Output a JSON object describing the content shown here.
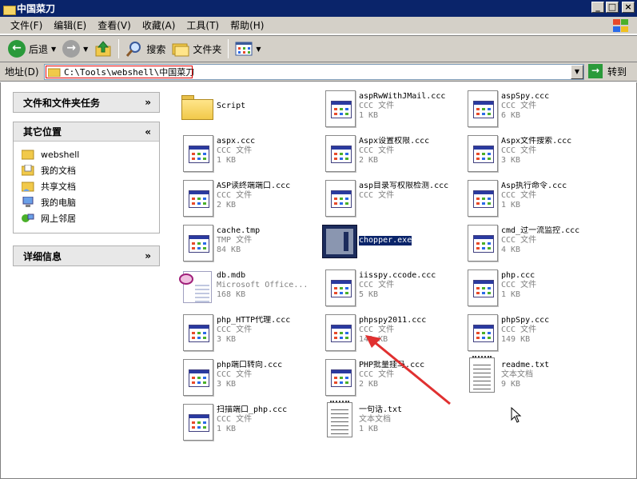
{
  "window": {
    "title": "中国菜刀"
  },
  "menubar": [
    "文件(F)",
    "编辑(E)",
    "查看(V)",
    "收藏(A)",
    "工具(T)",
    "帮助(H)"
  ],
  "toolbar": {
    "back": "后退",
    "search": "搜索",
    "folders": "文件夹"
  },
  "address": {
    "label": "地址(D)",
    "path": "C:\\Tools\\webshell\\中国菜刀",
    "go": "转到"
  },
  "sidebar": {
    "panels": [
      {
        "title": "文件和文件夹任务",
        "items": []
      },
      {
        "title": "其它位置",
        "items": [
          "webshell",
          "我的文档",
          "共享文档",
          "我的电脑",
          "网上邻居"
        ]
      },
      {
        "title": "详细信息",
        "items": []
      }
    ]
  },
  "files": [
    {
      "name": "Script",
      "type": "",
      "size": "",
      "icon": "folder-icon"
    },
    {
      "name": "aspRwWithJMail.ccc",
      "type": "CCC 文件",
      "size": "1 KB",
      "icon": "ccc-file-icon"
    },
    {
      "name": "aspSpy.ccc",
      "type": "CCC 文件",
      "size": "6 KB",
      "icon": "ccc-file-icon"
    },
    {
      "name": "aspx.ccc",
      "type": "CCC 文件",
      "size": "1 KB",
      "icon": "ccc-file-icon"
    },
    {
      "name": "Aspx设置权限.ccc",
      "type": "CCC 文件",
      "size": "2 KB",
      "icon": "ccc-file-icon"
    },
    {
      "name": "Aspx文件搜索.ccc",
      "type": "CCC 文件",
      "size": "3 KB",
      "icon": "ccc-file-icon"
    },
    {
      "name": "ASP读终端端口.ccc",
      "type": "CCC 文件",
      "size": "2 KB",
      "icon": "ccc-file-icon"
    },
    {
      "name": "asp目录写权限检测.ccc",
      "type": "CCC 文件",
      "size": "",
      "icon": "ccc-file-icon"
    },
    {
      "name": "Asp执行命令.ccc",
      "type": "CCC 文件",
      "size": "1 KB",
      "icon": "ccc-file-icon"
    },
    {
      "name": "cache.tmp",
      "type": "TMP 文件",
      "size": "84 KB",
      "icon": "ccc-file-icon"
    },
    {
      "name": "chopper.exe",
      "type": "",
      "size": "",
      "icon": "exe-icon"
    },
    {
      "name": "cmd_过一流监控.ccc",
      "type": "CCC 文件",
      "size": "4 KB",
      "icon": "ccc-file-icon"
    },
    {
      "name": "db.mdb",
      "type": "Microsoft Office...",
      "size": "168 KB",
      "icon": "mdb-icon"
    },
    {
      "name": "iisspy.ccode.ccc",
      "type": "CCC 文件",
      "size": "5 KB",
      "icon": "ccc-file-icon"
    },
    {
      "name": "php.ccc",
      "type": "CCC 文件",
      "size": "1 KB",
      "icon": "ccc-file-icon"
    },
    {
      "name": "php_HTTP代理.ccc",
      "type": "CCC 文件",
      "size": "3 KB",
      "icon": "ccc-file-icon"
    },
    {
      "name": "phpspy2011.ccc",
      "type": "CCC 文件",
      "size": "149 KB",
      "icon": "ccc-file-icon"
    },
    {
      "name": "phpSpy.ccc",
      "type": "CCC 文件",
      "size": "149 KB",
      "icon": "ccc-file-icon"
    },
    {
      "name": "php端口转向.ccc",
      "type": "CCC 文件",
      "size": "3 KB",
      "icon": "ccc-file-icon"
    },
    {
      "name": "PHP批量挂马.ccc",
      "type": "CCC 文件",
      "size": "2 KB",
      "icon": "ccc-file-icon"
    },
    {
      "name": "readme.txt",
      "type": "文本文档",
      "size": "9 KB",
      "icon": "txt-icon"
    },
    {
      "name": "扫描端口_php.ccc",
      "type": "CCC 文件",
      "size": "1 KB",
      "icon": "ccc-file-icon"
    },
    {
      "name": "一句话.txt",
      "type": "文本文档",
      "size": "1 KB",
      "icon": "txt-icon"
    }
  ],
  "colors": {
    "titlebar": "#0a246a",
    "chrome": "#d4d0c8",
    "selection": "#0a246a",
    "annotation": "#e03030"
  }
}
